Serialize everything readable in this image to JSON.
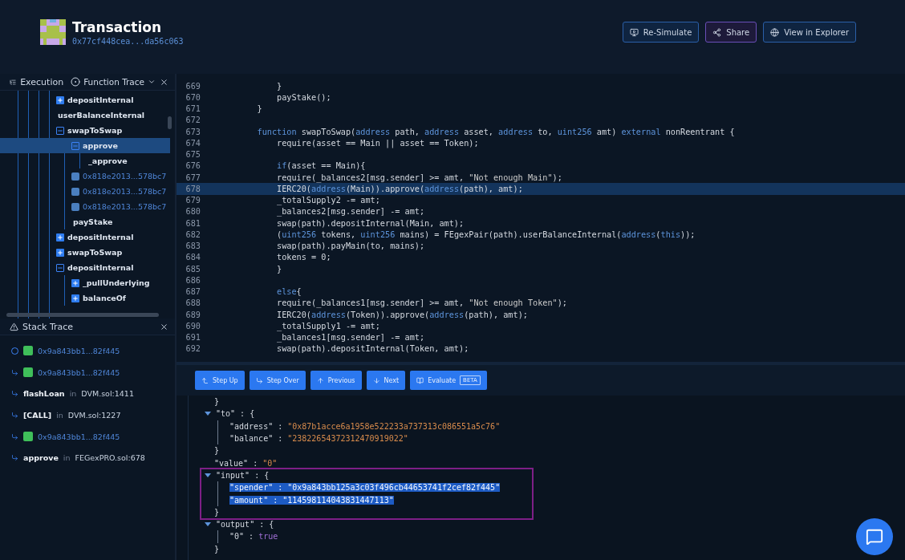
{
  "header": {
    "title": "Transaction",
    "hash": "0x77cf448cea...da56c063",
    "buttons": [
      {
        "label": "Re-Simulate",
        "kind": "simulate"
      },
      {
        "label": "Share",
        "kind": "share"
      },
      {
        "label": "View in Explorer",
        "kind": "explorer"
      }
    ]
  },
  "execution": {
    "title": "Execution",
    "mode": "Function Trace",
    "tree": [
      {
        "label": "depositInternal",
        "kind": "call",
        "expanded": false,
        "selected": false
      },
      {
        "label": "userBalanceInternal",
        "kind": "leaf",
        "selected": false
      },
      {
        "label": "swapToSwap",
        "kind": "call",
        "expanded": true,
        "selected": false,
        "children": [
          {
            "label": "approve",
            "kind": "call",
            "expanded": true,
            "selected": true,
            "children": [
              {
                "label": "_approve",
                "kind": "leaf",
                "selected": false
              }
            ]
          },
          {
            "label": "0x818e2013...578bc7",
            "kind": "contract",
            "selected": false
          },
          {
            "label": "0x818e2013...578bc7",
            "kind": "contract",
            "selected": false
          },
          {
            "label": "0x818e2013...578bc7",
            "kind": "contract",
            "selected": false
          },
          {
            "label": "payStake",
            "kind": "leaf",
            "selected": false
          }
        ]
      },
      {
        "label": "depositInternal",
        "kind": "call",
        "expanded": false,
        "selected": false
      },
      {
        "label": "swapToSwap",
        "kind": "call",
        "expanded": false,
        "selected": false
      },
      {
        "label": "depositInternal",
        "kind": "call",
        "expanded": true,
        "selected": false,
        "children": [
          {
            "label": "_pullUnderlying",
            "kind": "call",
            "expanded": false,
            "selected": false
          },
          {
            "label": "balanceOf",
            "kind": "call",
            "expanded": false,
            "selected": false
          }
        ]
      }
    ]
  },
  "stack_trace": {
    "title": "Stack Trace",
    "items": [
      {
        "kind": "address",
        "current": true,
        "label": "0x9a843bb1...82f445"
      },
      {
        "kind": "address",
        "current": false,
        "label": "0x9a843bb1...82f445"
      },
      {
        "kind": "frame",
        "current": false,
        "function": "flashLoan",
        "joiner": "in",
        "location": "DVM.sol:1411"
      },
      {
        "kind": "frame",
        "current": false,
        "function": "[CALL]",
        "joiner": "in",
        "location": "DVM.sol:1227"
      },
      {
        "kind": "address",
        "current": false,
        "label": "0x9a843bb1...82f445"
      },
      {
        "kind": "frame",
        "current": false,
        "function": "approve",
        "joiner": "in",
        "location": "FEGexPRO.sol:678"
      }
    ]
  },
  "code": {
    "lines": [
      {
        "number": "669",
        "current": false,
        "segments": [
          {
            "text": "        }",
            "kind": "plain"
          }
        ]
      },
      {
        "number": "670",
        "current": false,
        "segments": [
          {
            "text": "        payStake();",
            "kind": "plain"
          }
        ]
      },
      {
        "number": "671",
        "current": false,
        "segments": [
          {
            "text": "    }",
            "kind": "plain"
          }
        ]
      },
      {
        "number": "672",
        "current": false
      },
      {
        "number": "673",
        "current": false,
        "segments": [
          {
            "text": "    function",
            "kind": "keyword"
          },
          {
            "text": " swapToSwap(",
            "kind": "plain"
          },
          {
            "text": "address",
            "kind": "keyword"
          },
          {
            "text": " path, ",
            "kind": "plain"
          },
          {
            "text": "address",
            "kind": "keyword"
          },
          {
            "text": " asset, ",
            "kind": "plain"
          },
          {
            "text": "address",
            "kind": "keyword"
          },
          {
            "text": " to, ",
            "kind": "plain"
          },
          {
            "text": "uint256",
            "kind": "keyword"
          },
          {
            "text": " amt) ",
            "kind": "plain"
          },
          {
            "text": "external",
            "kind": "keyword"
          },
          {
            "text": " nonReentrant {",
            "kind": "plain"
          }
        ]
      },
      {
        "number": "674",
        "current": false,
        "segments": [
          {
            "text": "        require(asset == Main || asset == Token);",
            "kind": "plain"
          }
        ]
      },
      {
        "number": "675",
        "current": false
      },
      {
        "number": "676",
        "current": false,
        "segments": [
          {
            "text": "        if",
            "kind": "keyword"
          },
          {
            "text": "(asset == Main){",
            "kind": "plain"
          }
        ]
      },
      {
        "number": "677",
        "current": false,
        "segments": [
          {
            "text": "        require(_balances2[msg.sender] >= amt, ",
            "kind": "plain"
          },
          {
            "text": "\"Not enough Main\"",
            "kind": "string"
          },
          {
            "text": ");",
            "kind": "plain"
          }
        ]
      },
      {
        "number": "678",
        "current": true,
        "segments": [
          {
            "text": "        IERC20(",
            "kind": "plain"
          },
          {
            "text": "address",
            "kind": "keyword"
          },
          {
            "text": "(Main)).approve(",
            "kind": "plain"
          },
          {
            "text": "address",
            "kind": "keyword"
          },
          {
            "text": "(path), amt);",
            "kind": "plain"
          }
        ]
      },
      {
        "number": "679",
        "current": false,
        "segments": [
          {
            "text": "        _totalSupply2 -= amt;",
            "kind": "plain"
          }
        ]
      },
      {
        "number": "680",
        "current": false,
        "segments": [
          {
            "text": "        _balances2[msg.sender] -= amt;",
            "kind": "plain"
          }
        ]
      },
      {
        "number": "681",
        "current": false,
        "segments": [
          {
            "text": "        swap(path).depositInternal(Main, amt);",
            "kind": "plain"
          }
        ]
      },
      {
        "number": "682",
        "current": false,
        "segments": [
          {
            "text": "        (",
            "kind": "plain"
          },
          {
            "text": "uint256",
            "kind": "keyword"
          },
          {
            "text": " tokens, ",
            "kind": "plain"
          },
          {
            "text": "uint256",
            "kind": "keyword"
          },
          {
            "text": " mains) = FEgexPair(path).userBalanceInternal(",
            "kind": "plain"
          },
          {
            "text": "address",
            "kind": "keyword"
          },
          {
            "text": "(",
            "kind": "plain"
          },
          {
            "text": "this",
            "kind": "keyword"
          },
          {
            "text": "));",
            "kind": "plain"
          }
        ]
      },
      {
        "number": "683",
        "current": false,
        "segments": [
          {
            "text": "        swap(path).payMain(to, mains);",
            "kind": "plain"
          }
        ]
      },
      {
        "number": "684",
        "current": false,
        "segments": [
          {
            "text": "        tokens = 0;",
            "kind": "plain"
          }
        ]
      },
      {
        "number": "685",
        "current": false,
        "segments": [
          {
            "text": "        }",
            "kind": "plain"
          }
        ]
      },
      {
        "number": "686",
        "current": false
      },
      {
        "number": "687",
        "current": false,
        "segments": [
          {
            "text": "        else",
            "kind": "keyword"
          },
          {
            "text": "{",
            "kind": "plain"
          }
        ]
      },
      {
        "number": "688",
        "current": false,
        "segments": [
          {
            "text": "        require(_balances1[msg.sender] >= amt, ",
            "kind": "plain"
          },
          {
            "text": "\"Not enough Token\"",
            "kind": "string"
          },
          {
            "text": ");",
            "kind": "plain"
          }
        ]
      },
      {
        "number": "689",
        "current": false,
        "segments": [
          {
            "text": "        IERC20(",
            "kind": "plain"
          },
          {
            "text": "address",
            "kind": "keyword"
          },
          {
            "text": "(Token)).approve(",
            "kind": "plain"
          },
          {
            "text": "address",
            "kind": "keyword"
          },
          {
            "text": "(path), amt);",
            "kind": "plain"
          }
        ]
      },
      {
        "number": "690",
        "current": false,
        "segments": [
          {
            "text": "        _totalSupply1 -= amt;",
            "kind": "plain"
          }
        ]
      },
      {
        "number": "691",
        "current": false,
        "segments": [
          {
            "text": "        _balances1[msg.sender] -= amt;",
            "kind": "plain"
          }
        ]
      },
      {
        "number": "692",
        "current": false,
        "segments": [
          {
            "text": "        swap(path).depositInternal(Token, amt);",
            "kind": "plain"
          }
        ]
      }
    ]
  },
  "debugger": {
    "buttons": [
      {
        "label": "Step Up",
        "kind": "step-up"
      },
      {
        "label": "Step Over",
        "kind": "step-over"
      },
      {
        "label": "Previous",
        "kind": "previous"
      },
      {
        "label": "Next",
        "kind": "next"
      },
      {
        "label": "Evaluate",
        "kind": "evaluate",
        "badge": "BETA"
      }
    ]
  },
  "inspector": {
    "nodes": [
      {
        "segments": [
          {
            "text": "}",
            "kind": "punct"
          }
        ]
      },
      {
        "expanded": true,
        "highlighted": false,
        "segments": [
          {
            "text": "\"to\"",
            "kind": "key"
          },
          {
            "text": " : ",
            "kind": "punct"
          },
          {
            "text": "{",
            "kind": "punct"
          }
        ],
        "children": [
          {
            "segments": [
              {
                "text": "\"address\"",
                "kind": "key",
                "selected": false
              },
              {
                "text": " : ",
                "kind": "punct",
                "selected": false
              },
              {
                "text": "\"0x87b1acce6a1958e522233a737313c086551a5c76\"",
                "kind": "string",
                "selected": false
              }
            ]
          },
          {
            "segments": [
              {
                "text": "\"balance\"",
                "kind": "key",
                "selected": false
              },
              {
                "text": " : ",
                "kind": "punct",
                "selected": false
              },
              {
                "text": "\"23822654372312470919022\"",
                "kind": "string",
                "selected": false
              }
            ]
          }
        ],
        "closing": "}"
      },
      {
        "segments": [
          {
            "text": "\"value\"",
            "kind": "key"
          },
          {
            "text": " : ",
            "kind": "punct"
          },
          {
            "text": "\"0\"",
            "kind": "string"
          }
        ]
      },
      {
        "expanded": true,
        "highlighted": true,
        "segments": [
          {
            "text": "\"input\"",
            "kind": "key"
          },
          {
            "text": " : ",
            "kind": "punct"
          },
          {
            "text": "{",
            "kind": "punct"
          }
        ],
        "children": [
          {
            "segments": [
              {
                "text": "\"spender\"",
                "kind": "key",
                "selected": true
              },
              {
                "text": " : ",
                "kind": "punct",
                "selected": true
              },
              {
                "text": "\"0x9a843bb125a3c03f496cb44653741f2cef82f445\"",
                "kind": "string",
                "selected": true
              }
            ]
          },
          {
            "segments": [
              {
                "text": "\"amount\"",
                "kind": "key",
                "selected": true
              },
              {
                "text": " : ",
                "kind": "punct",
                "selected": true
              },
              {
                "text": "\"114598114043831447113\"",
                "kind": "string",
                "selected": true
              }
            ]
          }
        ],
        "closing": "}"
      },
      {
        "expanded": true,
        "highlighted": false,
        "segments": [
          {
            "text": "\"output\"",
            "kind": "key"
          },
          {
            "text": " : ",
            "kind": "punct"
          },
          {
            "text": "{",
            "kind": "punct"
          }
        ],
        "children": [
          {
            "segments": [
              {
                "text": "\"0\"",
                "kind": "key",
                "selected": false
              },
              {
                "text": " : ",
                "kind": "punct",
                "selected": false
              },
              {
                "text": "true",
                "kind": "boolean",
                "selected": false
              }
            ]
          }
        ],
        "closing": "}"
      }
    ]
  }
}
